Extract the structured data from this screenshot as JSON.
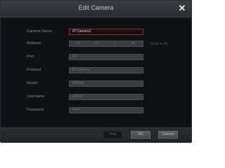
{
  "dialog": {
    "title": "Edit Camera",
    "close_glyph": "✕"
  },
  "form": {
    "camera_name": {
      "label": "Camera Name",
      "value": "IP Camera1"
    },
    "address": {
      "label": "Address",
      "segments": [
        "11",
        "16",
        "7",
        "93"
      ],
      "hint": "(Scan is IP)"
    },
    "port": {
      "label": "Port",
      "value": "80"
    },
    "protocol": {
      "label": "Protocol",
      "value": "IP Camera"
    },
    "model": {
      "label": "Model",
      "value": "MODEL"
    },
    "username": {
      "label": "Username",
      "value": "admin"
    },
    "password": {
      "label": "Password",
      "value": "••••••"
    }
  },
  "buttons": {
    "test": "Test",
    "ok": "OK",
    "cancel": "Cancel"
  },
  "colors": {
    "background": "#0e1013",
    "active_border": "#b32222",
    "field_bg": "#3a3c40"
  }
}
